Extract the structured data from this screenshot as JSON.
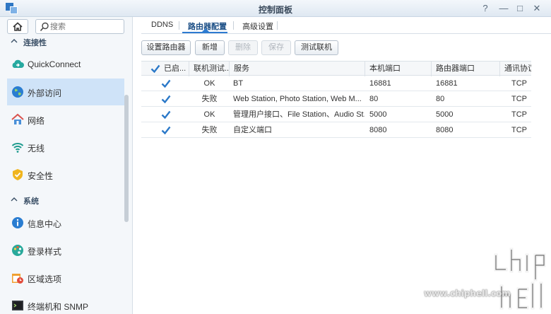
{
  "window": {
    "title": "控制面板",
    "help_label": "?",
    "min_label": "—",
    "max_label": "□",
    "close_label": "✕"
  },
  "sidebar": {
    "search_placeholder": "搜索",
    "sections": [
      {
        "label": "连接性"
      },
      {
        "label": "系统"
      }
    ],
    "items": [
      {
        "label": "QuickConnect",
        "icon": "quickconnect-cloud-icon"
      },
      {
        "label": "外部访问",
        "icon": "globe-icon",
        "active": true
      },
      {
        "label": "网络",
        "icon": "network-house-icon"
      },
      {
        "label": "无线",
        "icon": "wifi-icon"
      },
      {
        "label": "安全性",
        "icon": "shield-icon"
      },
      {
        "label": "信息中心",
        "icon": "info-icon"
      },
      {
        "label": "登录样式",
        "icon": "palette-icon"
      },
      {
        "label": "区域选项",
        "icon": "calendar-clock-icon"
      },
      {
        "label": "终端机和 SNMP",
        "icon": "terminal-icon"
      }
    ]
  },
  "tabs": [
    {
      "label": "DDNS"
    },
    {
      "label": "路由器配置",
      "active": true
    },
    {
      "label": "高级设置"
    }
  ],
  "toolbar": {
    "setup_router": "设置路由器",
    "add": "新增",
    "delete": "删除",
    "save": "保存",
    "test_connection": "测试联机"
  },
  "grid": {
    "headers": {
      "enabled": "已启...",
      "test": "联机测试...",
      "service": "服务",
      "local_port": "本机端口",
      "router_port": "路由器端口",
      "protocol": "通讯协议"
    },
    "rows": [
      {
        "test": "OK",
        "service": "BT",
        "local_port": "16881",
        "router_port": "16881",
        "protocol": "TCP"
      },
      {
        "test": "失败",
        "service": "Web Station, Photo Station, Web M...",
        "local_port": "80",
        "router_port": "80",
        "protocol": "TCP"
      },
      {
        "test": "OK",
        "service": "管理用户接口、File Station、Audio St...",
        "local_port": "5000",
        "router_port": "5000",
        "protocol": "TCP"
      },
      {
        "test": "失败",
        "service": "自定义端口",
        "local_port": "8080",
        "router_port": "8080",
        "protocol": "TCP"
      }
    ]
  },
  "watermark": {
    "text": "www.chiphell.com"
  },
  "colors": {
    "accent": "#2e7bd0",
    "active_item": "#cfe3f8",
    "check": "#2a78c8"
  }
}
